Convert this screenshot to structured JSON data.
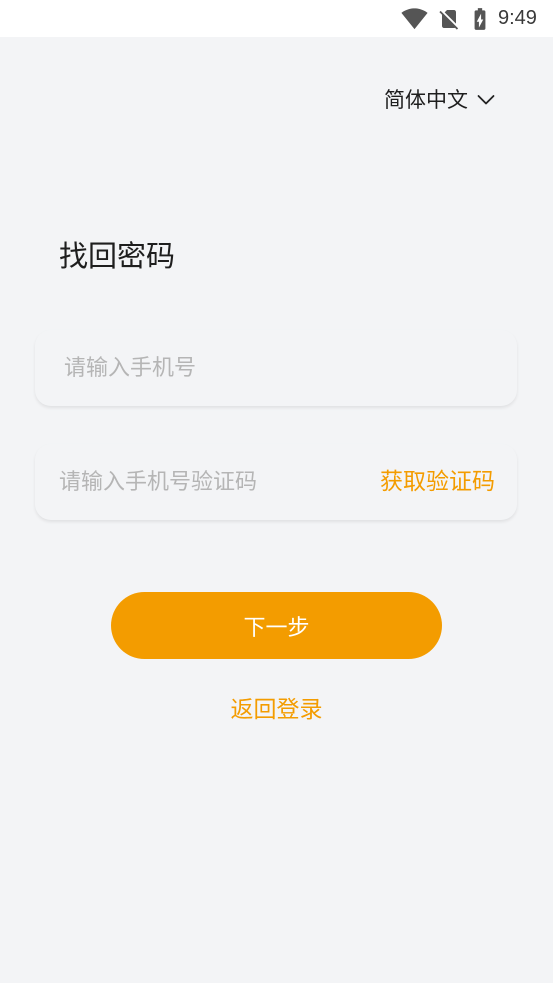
{
  "status_bar": {
    "time": "9:49",
    "icons": [
      "wifi-icon",
      "no-sim-icon",
      "battery-charging-icon"
    ]
  },
  "language": {
    "label": "简体中文",
    "icon": "chevron-down-icon"
  },
  "page": {
    "title": "找回密码"
  },
  "form": {
    "phone": {
      "value": "",
      "placeholder": "请输入手机号"
    },
    "code": {
      "value": "",
      "placeholder": "请输入手机号验证码",
      "get_code_label": "获取验证码"
    }
  },
  "actions": {
    "next_label": "下一步",
    "back_login_label": "返回登录"
  },
  "colors": {
    "accent": "#F39C00",
    "background": "#F3F4F6",
    "status_bar": "#FFFFFF",
    "placeholder": "#B5B5B5",
    "text": "#1E1E1E"
  }
}
